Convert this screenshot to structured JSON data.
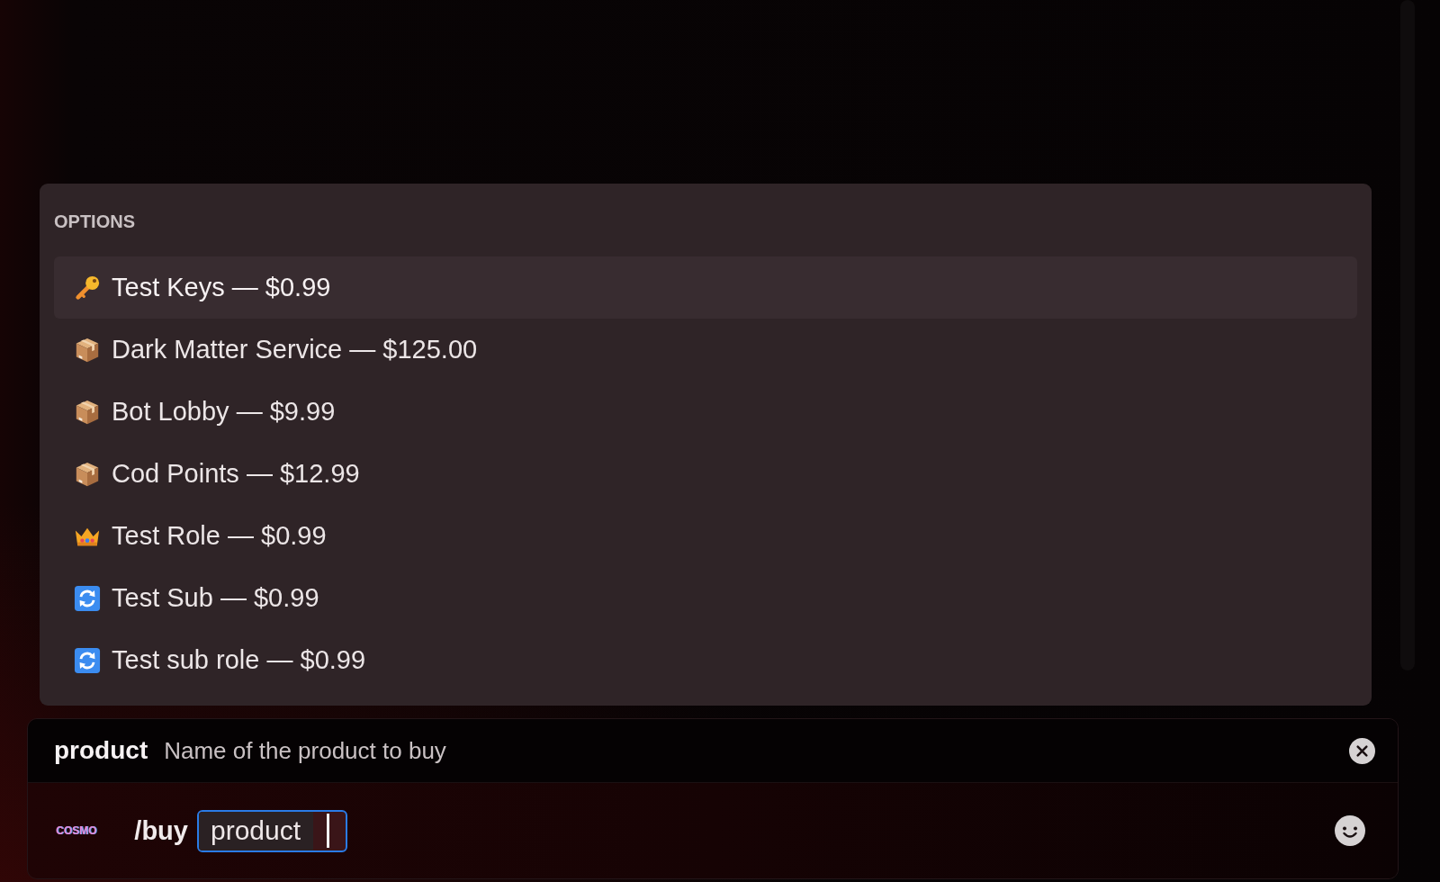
{
  "options_panel": {
    "heading": "OPTIONS",
    "items": [
      {
        "kind": "key",
        "label": "Test Keys — $0.99",
        "selected": true
      },
      {
        "kind": "item",
        "label": "Dark Matter Service — $125.00",
        "selected": false
      },
      {
        "kind": "item",
        "label": "Bot Lobby — $9.99",
        "selected": false
      },
      {
        "kind": "item",
        "label": "Cod Points — $12.99",
        "selected": false
      },
      {
        "kind": "role",
        "label": "Test Role — $0.99",
        "selected": false
      },
      {
        "kind": "subscription",
        "label": "Test Sub — $0.99",
        "selected": false
      },
      {
        "kind": "subscription",
        "label": "Test sub role — $0.99",
        "selected": false
      }
    ]
  },
  "option_hint": {
    "name": "product",
    "description": "Name of the product to buy"
  },
  "composer": {
    "logo_text": "COSMO",
    "command": "/buy",
    "input": {
      "value": "product",
      "focused": true
    }
  }
}
